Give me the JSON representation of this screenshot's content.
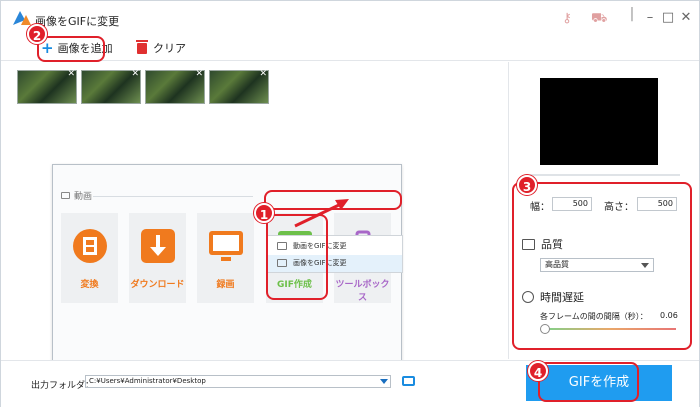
{
  "window": {
    "title": "画像をGIFに変更",
    "buttons": [
      "minimize",
      "maximize",
      "close"
    ]
  },
  "toolbar": {
    "add_label": "画像を追加",
    "clear_label": "クリア"
  },
  "thumbnails_count": 4,
  "inset": {
    "section_label": "動画",
    "tiles": [
      {
        "label": "変換",
        "color": "#f07a1e",
        "icon": "film-icon"
      },
      {
        "label": "ダウンロード",
        "color": "#f07a1e",
        "icon": "download-icon"
      },
      {
        "label": "録画",
        "color": "#f07a1e",
        "icon": "screen-record-icon"
      },
      {
        "label": "GIF作成",
        "color": "#6dc04a",
        "icon": "image-icon"
      },
      {
        "label": "ツールボックス",
        "color": "#a867c8",
        "icon": "toolbox-icon"
      }
    ],
    "menu": {
      "items": [
        "動画をGIFに変更",
        "画像をGIFに変更"
      ]
    }
  },
  "callouts": {
    "badge_1": "1",
    "badge_2": "2",
    "badge_3": "3",
    "badge_4": "4"
  },
  "settings": {
    "width_label": "幅：",
    "width_value": "500",
    "height_label": "高さ：",
    "height_value": "500",
    "quality_title": "品質",
    "quality_value": "高品質",
    "delay_title": "時間遅延",
    "delay_label": "各フレームの間の間隔（秒）：",
    "delay_value": "0.06"
  },
  "bottom": {
    "output_label": "出力フォルダ：",
    "output_path": "C:¥Users¥Administrator¥Desktop",
    "create_label": "GIFを作成"
  },
  "colors": {
    "accent": "#1f9cf0",
    "callout": "#e0202a"
  }
}
